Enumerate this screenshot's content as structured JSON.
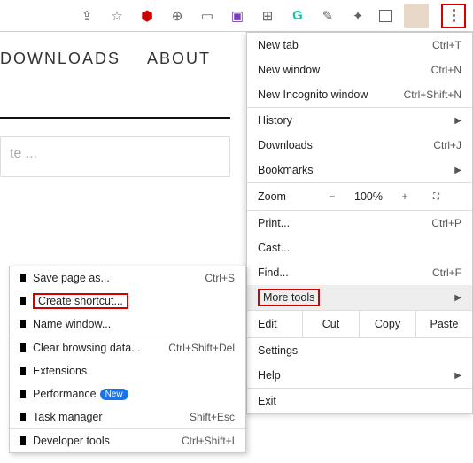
{
  "page": {
    "nav": {
      "downloads": "DOWNLOADS",
      "about": "ABOUT"
    },
    "input_placeholder": "te ..."
  },
  "menu": {
    "new_tab": "New tab",
    "new_tab_k": "Ctrl+T",
    "new_window": "New window",
    "new_window_k": "Ctrl+N",
    "incognito": "New Incognito window",
    "incognito_k": "Ctrl+Shift+N",
    "history": "History",
    "downloads": "Downloads",
    "downloads_k": "Ctrl+J",
    "bookmarks": "Bookmarks",
    "zoom": "Zoom",
    "zoom_pct": "100%",
    "minus": "−",
    "plus": "+",
    "print": "Print...",
    "print_k": "Ctrl+P",
    "cast": "Cast...",
    "find": "Find...",
    "find_k": "Ctrl+F",
    "more_tools": "More tools",
    "edit": "Edit",
    "cut": "Cut",
    "copy": "Copy",
    "paste": "Paste",
    "settings": "Settings",
    "help": "Help",
    "exit": "Exit"
  },
  "submenu": {
    "save_as": "Save page as...",
    "save_as_k": "Ctrl+S",
    "create_shortcut": "Create shortcut...",
    "name_window": "Name window...",
    "clear_data": "Clear browsing data...",
    "clear_data_k": "Ctrl+Shift+Del",
    "extensions": "Extensions",
    "performance": "Performance",
    "new_badge": "New",
    "task_manager": "Task manager",
    "task_manager_k": "Shift+Esc",
    "dev_tools": "Developer tools",
    "dev_tools_k": "Ctrl+Shift+I"
  }
}
